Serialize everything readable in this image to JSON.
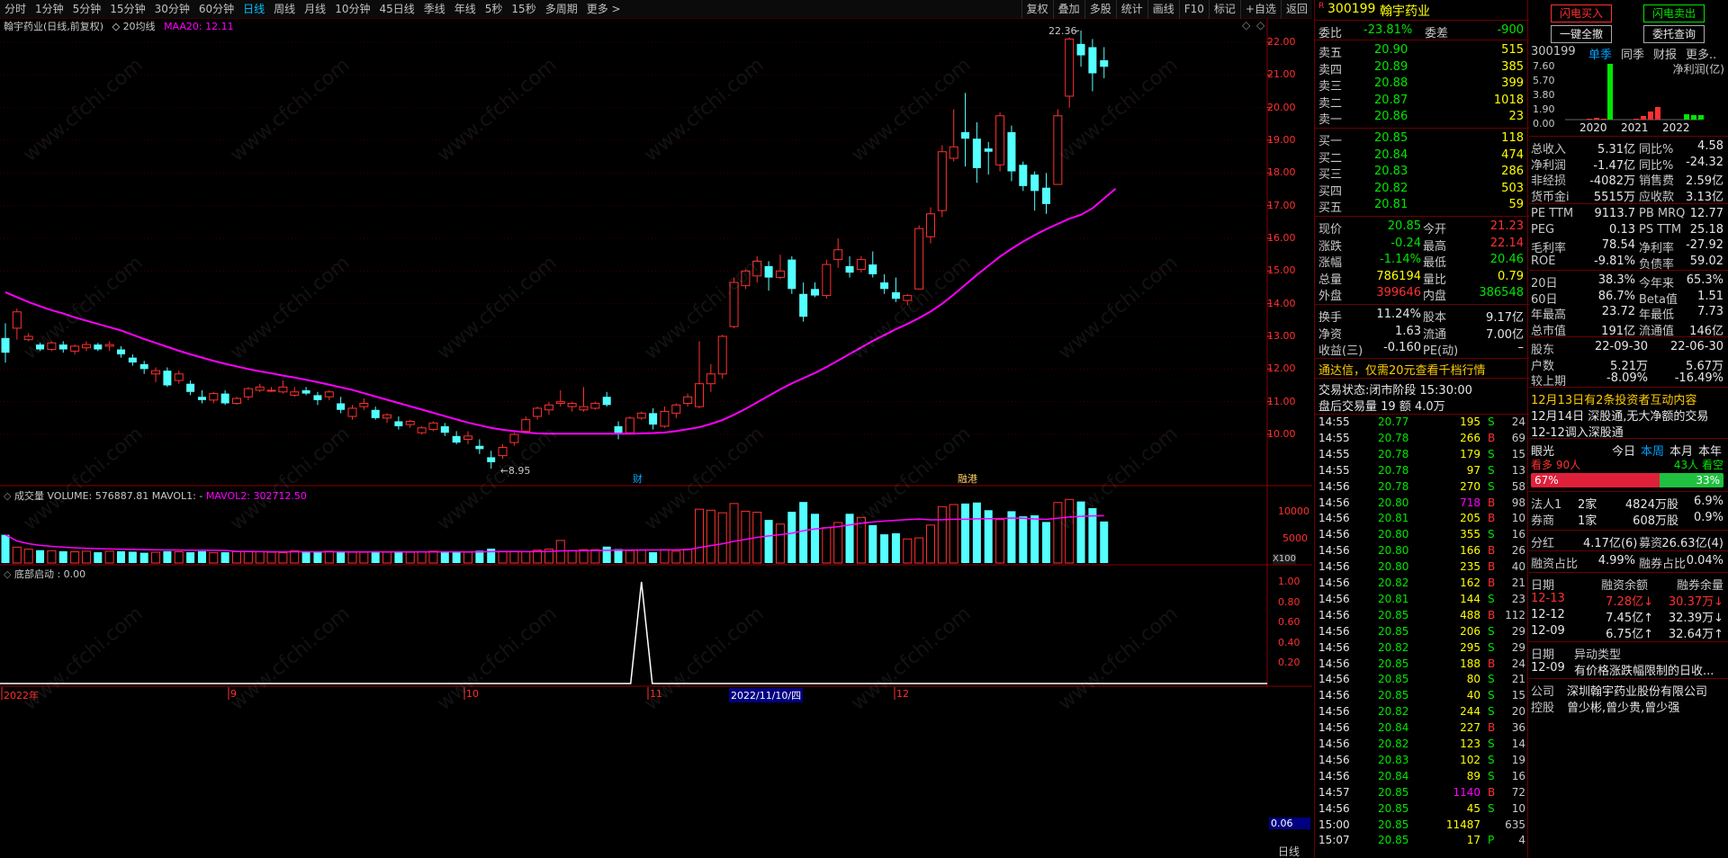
{
  "toolbar": {
    "periods": [
      "分时",
      "1分钟",
      "5分钟",
      "15分钟",
      "30分钟",
      "60分钟",
      "日线",
      "周线",
      "月线",
      "10分钟",
      "45日线",
      "季线",
      "年线",
      "5秒",
      "15秒",
      "多周期",
      "更多 >"
    ],
    "active_period": "日线",
    "right_buttons": [
      "复权",
      "叠加",
      "多股",
      "统计",
      "画线",
      "F10",
      "标记",
      "+自选",
      "返回"
    ]
  },
  "chart": {
    "title": "翰宇药业(日线,前复权)",
    "ma_label": "20均线",
    "ma_value": "MAA20: 12.11",
    "high_label": "22.36",
    "low_label": "8.95",
    "price_axis": [
      "22.00",
      "21.00",
      "20.00",
      "19.00",
      "18.00",
      "17.00",
      "16.00",
      "15.00",
      "14.00",
      "13.00",
      "12.00",
      "11.00",
      "10.00"
    ],
    "marker_cai": "财",
    "marker_tags": "融港",
    "volume_title": "成交量 VOLUME: 576887.81 MAVOL1: -",
    "volume_mavol2": "MAVOL2: 302712.50",
    "volume_axis": [
      "10000",
      "5000"
    ],
    "volume_unit": "X100",
    "bottom_title": "底部启动 : 0.00",
    "bottom_axis": [
      "1.00",
      "0.80",
      "0.60",
      "0.40",
      "0.20"
    ],
    "bottom_value": "0.06",
    "date_axis": [
      "2022年",
      "9",
      "10",
      "11",
      "2022/11/10/四",
      "12"
    ],
    "period_tab": "日线"
  },
  "chart_data": {
    "type": "candlestick",
    "title": "翰宇药业(日线,前复权)",
    "ylim": [
      8.5,
      22.6
    ],
    "candles": [
      [
        12.95,
        13.4,
        12.2,
        12.5
      ],
      [
        13.25,
        13.85,
        12.9,
        13.75
      ],
      [
        12.9,
        13.1,
        12.85,
        13.0
      ],
      [
        12.75,
        12.8,
        12.55,
        12.6
      ],
      [
        12.6,
        12.85,
        12.55,
        12.8
      ],
      [
        12.75,
        12.85,
        12.5,
        12.6
      ],
      [
        12.55,
        12.75,
        12.45,
        12.7
      ],
      [
        12.65,
        12.85,
        12.55,
        12.75
      ],
      [
        12.75,
        12.8,
        12.55,
        12.6
      ],
      [
        12.7,
        12.85,
        12.55,
        12.75
      ],
      [
        12.6,
        12.7,
        12.35,
        12.45
      ],
      [
        12.35,
        12.45,
        12.1,
        12.2
      ],
      [
        12.15,
        12.25,
        11.85,
        12.0
      ],
      [
        11.85,
        12.05,
        11.6,
        11.95
      ],
      [
        11.95,
        12.05,
        11.45,
        11.5
      ],
      [
        11.65,
        11.95,
        11.55,
        11.85
      ],
      [
        11.55,
        11.65,
        11.2,
        11.3
      ],
      [
        11.15,
        11.35,
        10.95,
        11.05
      ],
      [
        11.05,
        11.3,
        10.95,
        11.25
      ],
      [
        11.25,
        11.35,
        10.9,
        10.95
      ],
      [
        10.95,
        11.15,
        10.9,
        11.1
      ],
      [
        11.15,
        11.45,
        11.05,
        11.4
      ],
      [
        11.35,
        11.55,
        11.3,
        11.45
      ],
      [
        11.35,
        11.45,
        11.3,
        11.35
      ],
      [
        11.3,
        11.65,
        11.25,
        11.45
      ],
      [
        11.2,
        11.45,
        11.15,
        11.3
      ],
      [
        11.35,
        11.45,
        11.2,
        11.25
      ],
      [
        11.2,
        11.3,
        10.9,
        11.05
      ],
      [
        11.15,
        11.35,
        11.05,
        11.3
      ],
      [
        10.95,
        11.15,
        10.65,
        10.75
      ],
      [
        10.55,
        10.9,
        10.45,
        10.8
      ],
      [
        10.85,
        11.1,
        10.75,
        10.95
      ],
      [
        10.75,
        10.85,
        10.45,
        10.5
      ],
      [
        10.5,
        10.65,
        10.35,
        10.6
      ],
      [
        10.4,
        10.55,
        10.15,
        10.25
      ],
      [
        10.3,
        10.45,
        10.2,
        10.4
      ],
      [
        10.05,
        10.25,
        10.0,
        10.2
      ],
      [
        10.15,
        10.4,
        10.1,
        10.35
      ],
      [
        10.25,
        10.35,
        9.95,
        10.05
      ],
      [
        9.95,
        10.1,
        9.7,
        9.75
      ],
      [
        9.85,
        10.1,
        9.7,
        9.95
      ],
      [
        9.65,
        9.85,
        9.4,
        9.55
      ],
      [
        9.3,
        9.5,
        8.95,
        9.15
      ],
      [
        9.35,
        9.7,
        9.25,
        9.6
      ],
      [
        9.75,
        10.05,
        9.65,
        10.0
      ],
      [
        10.1,
        10.55,
        10.05,
        10.45
      ],
      [
        10.55,
        10.85,
        10.45,
        10.8
      ],
      [
        10.75,
        11.0,
        10.6,
        10.9
      ],
      [
        10.95,
        11.35,
        10.85,
        11.0
      ],
      [
        10.85,
        11.0,
        10.7,
        10.95
      ],
      [
        10.75,
        11.45,
        10.7,
        10.85
      ],
      [
        10.8,
        11.0,
        10.75,
        10.95
      ],
      [
        11.15,
        11.3,
        10.85,
        10.9
      ],
      [
        10.25,
        10.4,
        9.85,
        10.05
      ],
      [
        10.05,
        10.55,
        10.0,
        10.5
      ],
      [
        10.5,
        10.7,
        10.45,
        10.65
      ],
      [
        10.65,
        10.8,
        10.15,
        10.3
      ],
      [
        10.25,
        10.85,
        10.2,
        10.7
      ],
      [
        10.65,
        10.95,
        10.5,
        10.9
      ],
      [
        10.95,
        11.25,
        10.85,
        11.15
      ],
      [
        10.85,
        12.85,
        10.8,
        11.55
      ],
      [
        11.55,
        12.15,
        11.3,
        11.85
      ],
      [
        11.85,
        13.05,
        11.7,
        13.0
      ],
      [
        13.3,
        14.8,
        13.25,
        14.65
      ],
      [
        14.55,
        15.05,
        14.45,
        15.0
      ],
      [
        14.85,
        15.45,
        14.65,
        15.3
      ],
      [
        15.15,
        15.3,
        14.4,
        14.8
      ],
      [
        14.8,
        15.5,
        14.75,
        15.0
      ],
      [
        15.35,
        15.45,
        14.3,
        14.45
      ],
      [
        14.3,
        14.65,
        13.45,
        13.6
      ],
      [
        14.45,
        14.65,
        14.2,
        14.25
      ],
      [
        14.25,
        15.35,
        14.15,
        15.2
      ],
      [
        15.35,
        16.0,
        15.1,
        15.65
      ],
      [
        15.15,
        15.45,
        14.8,
        14.95
      ],
      [
        15.05,
        15.45,
        14.95,
        15.35
      ],
      [
        15.2,
        15.6,
        14.8,
        14.9
      ],
      [
        14.65,
        14.9,
        14.3,
        14.45
      ],
      [
        14.35,
        14.8,
        14.05,
        14.15
      ],
      [
        14.1,
        14.3,
        13.95,
        14.25
      ],
      [
        14.45,
        16.4,
        14.45,
        16.3
      ],
      [
        16.05,
        16.95,
        15.85,
        16.75
      ],
      [
        16.85,
        18.85,
        16.65,
        18.65
      ],
      [
        18.45,
        19.95,
        18.35,
        18.8
      ],
      [
        19.25,
        20.45,
        18.2,
        19.05
      ],
      [
        19.05,
        19.55,
        17.7,
        18.15
      ],
      [
        18.75,
        18.95,
        17.95,
        18.65
      ],
      [
        18.25,
        19.85,
        18.05,
        19.75
      ],
      [
        19.25,
        19.45,
        17.75,
        18.05
      ],
      [
        18.25,
        18.35,
        17.45,
        17.6
      ],
      [
        17.95,
        18.05,
        16.85,
        17.45
      ],
      [
        17.55,
        18.0,
        16.75,
        17.05
      ],
      [
        17.65,
        19.95,
        17.65,
        19.75
      ],
      [
        20.35,
        22.15,
        20.0,
        22.1
      ],
      [
        21.95,
        22.36,
        21.25,
        21.6
      ],
      [
        21.85,
        22.1,
        20.5,
        21.05
      ],
      [
        21.45,
        21.85,
        20.9,
        21.25
      ]
    ],
    "ma20": [
      14.35,
      14.2,
      14.05,
      13.92,
      13.8,
      13.7,
      13.58,
      13.48,
      13.38,
      13.28,
      13.18,
      13.05,
      12.92,
      12.8,
      12.68,
      12.56,
      12.45,
      12.35,
      12.25,
      12.16,
      12.08,
      12.0,
      11.93,
      11.87,
      11.8,
      11.74,
      11.67,
      11.6,
      11.52,
      11.44,
      11.36,
      11.26,
      11.16,
      11.06,
      10.96,
      10.86,
      10.76,
      10.66,
      10.56,
      10.46,
      10.36,
      10.28,
      10.2,
      10.14,
      10.1,
      10.06,
      10.03,
      10.02,
      10.02,
      10.02,
      10.02,
      10.02,
      10.02,
      10.02,
      10.02,
      10.03,
      10.04,
      10.06,
      10.1,
      10.16,
      10.22,
      10.32,
      10.44,
      10.6,
      10.78,
      10.98,
      11.18,
      11.38,
      11.56,
      11.72,
      11.88,
      12.06,
      12.26,
      12.46,
      12.66,
      12.86,
      13.04,
      13.22,
      13.38,
      13.56,
      13.76,
      14.0,
      14.28,
      14.58,
      14.88,
      15.16,
      15.44,
      15.68,
      15.9,
      16.1,
      16.28,
      16.44,
      16.6,
      16.72,
      16.92,
      17.22,
      17.52
    ]
  },
  "book": {
    "code": "300199",
    "name": "翰宇药业",
    "weibi_label": "委比",
    "weibi": "-23.81%",
    "weicha_label": "委差",
    "weicha": "-900",
    "sells": [
      {
        "label": "卖五",
        "price": "20.90",
        "vol": "515"
      },
      {
        "label": "卖四",
        "price": "20.89",
        "vol": "385"
      },
      {
        "label": "卖三",
        "price": "20.88",
        "vol": "399"
      },
      {
        "label": "卖二",
        "price": "20.87",
        "vol": "1018"
      },
      {
        "label": "卖一",
        "price": "20.86",
        "vol": "23"
      }
    ],
    "buys": [
      {
        "label": "买一",
        "price": "20.85",
        "vol": "118"
      },
      {
        "label": "买二",
        "price": "20.84",
        "vol": "474"
      },
      {
        "label": "买三",
        "price": "20.83",
        "vol": "286"
      },
      {
        "label": "买四",
        "price": "20.82",
        "vol": "503"
      },
      {
        "label": "买五",
        "price": "20.81",
        "vol": "59"
      }
    ],
    "quotes": [
      {
        "l1": "现价",
        "v1": "20.85",
        "l2": "今开",
        "v2": "21.23"
      },
      {
        "l1": "涨跌",
        "v1": "-0.24",
        "l2": "最高",
        "v2": "22.14"
      },
      {
        "l1": "涨幅",
        "v1": "-1.14%",
        "l2": "最低",
        "v2": "20.46"
      },
      {
        "l1": "总量",
        "v1": "786194",
        "l2": "量比",
        "v2": "0.79"
      },
      {
        "l1": "外盘",
        "v1": "399646",
        "l2": "内盘",
        "v2": "386548"
      }
    ],
    "stats": [
      {
        "l1": "换手",
        "v1": "11.24%",
        "l2": "股本",
        "v2": "9.17亿"
      },
      {
        "l1": "净资",
        "v1": "1.63",
        "l2": "流通",
        "v2": "7.00亿"
      },
      {
        "l1": "收益(三)",
        "v1": "-0.160",
        "l2": "PE(动)",
        "v2": "–"
      }
    ],
    "promo": "通达信，仅需20元查看千档行情",
    "status": "交易状态:闭市阶段 15:30:00",
    "after": "盘后交易量 19 额 4.0万",
    "ticks": [
      [
        "14:55",
        "20.77",
        "195",
        "S",
        "24"
      ],
      [
        "14:55",
        "20.78",
        "266",
        "B",
        "69"
      ],
      [
        "14:55",
        "20.78",
        "179",
        "S",
        "15"
      ],
      [
        "14:55",
        "20.78",
        "97",
        "S",
        "13"
      ],
      [
        "14:56",
        "20.78",
        "270",
        "S",
        "58"
      ],
      [
        "14:56",
        "20.80",
        "718",
        "B",
        "98"
      ],
      [
        "14:56",
        "20.81",
        "205",
        "B",
        "10"
      ],
      [
        "14:56",
        "20.80",
        "355",
        "S",
        "16"
      ],
      [
        "14:56",
        "20.80",
        "166",
        "B",
        "26"
      ],
      [
        "14:56",
        "20.80",
        "235",
        "B",
        "40"
      ],
      [
        "14:56",
        "20.82",
        "162",
        "B",
        "21"
      ],
      [
        "14:56",
        "20.81",
        "144",
        "S",
        "23"
      ],
      [
        "14:56",
        "20.85",
        "488",
        "B",
        "112"
      ],
      [
        "14:56",
        "20.85",
        "206",
        "S",
        "29"
      ],
      [
        "14:56",
        "20.82",
        "295",
        "S",
        "29"
      ],
      [
        "14:56",
        "20.85",
        "188",
        "B",
        "24"
      ],
      [
        "14:56",
        "20.85",
        "80",
        "S",
        "21"
      ],
      [
        "14:56",
        "20.85",
        "40",
        "S",
        "15"
      ],
      [
        "14:56",
        "20.82",
        "244",
        "S",
        "20"
      ],
      [
        "14:56",
        "20.84",
        "227",
        "B",
        "36"
      ],
      [
        "14:56",
        "20.82",
        "123",
        "S",
        "14"
      ],
      [
        "14:56",
        "20.83",
        "102",
        "S",
        "19"
      ],
      [
        "14:56",
        "20.84",
        "89",
        "S",
        "16"
      ],
      [
        "14:57",
        "20.85",
        "1140",
        "B",
        "72"
      ],
      [
        "14:56",
        "20.85",
        "45",
        "S",
        "10"
      ],
      [
        "15:00",
        "20.85",
        "11487",
        "",
        "635"
      ],
      [
        "15:07",
        "20.85",
        "17",
        "P",
        "4"
      ]
    ]
  },
  "info": {
    "flash_buy": "闪电买入",
    "flash_sell": "闪电卖出",
    "one_key": "一键全撤",
    "order_query": "委托查询",
    "code": "300199",
    "tabs": [
      "单季",
      "同季",
      "财报",
      "更多.."
    ],
    "metric": "净利润(亿)",
    "bar_axis": [
      "7.60",
      "5.70",
      "3.80",
      "1.90",
      "0.00"
    ],
    "bar_years": [
      "2020",
      "2021",
      "2022"
    ],
    "fin": [
      {
        "l1": "总收入",
        "v1": "5.31亿",
        "l2": "同比%",
        "v2": "4.58"
      },
      {
        "l1": "净利润",
        "v1": "-1.47亿",
        "l2": "同比%",
        "v2": "-24.32"
      },
      {
        "l1": "非经损",
        "v1": "-4082万",
        "l2": "销售费",
        "v2": "2.59亿"
      },
      {
        "l1": "货币金i",
        "v1": "5515万",
        "l2": "应收款",
        "v2": "3.13亿"
      }
    ],
    "val": [
      {
        "l1": "PE TTM",
        "v1": "9113.7",
        "l2": "PB MRQ",
        "v2": "12.77"
      },
      {
        "l1": "PEG",
        "v1": "0.13",
        "l2": "PS TTM",
        "v2": "25.18"
      },
      {
        "l1": "毛利率",
        "v1": "78.54",
        "l2": "净利率",
        "v2": "-27.92"
      },
      {
        "l1": "ROE",
        "v1": "-9.81%",
        "l2": "负债率",
        "v2": "59.02"
      }
    ],
    "perf": [
      {
        "l1": "20日",
        "v1": "38.3%",
        "l2": "今年来",
        "v2": "65.3%"
      },
      {
        "l1": "60日",
        "v1": "86.7%",
        "l2": "Beta值",
        "v2": "1.51"
      },
      {
        "l1": "年最高",
        "v1": "23.72",
        "l2": "年最低",
        "v2": "7.73"
      },
      {
        "l1": "总市值",
        "v1": "191亿",
        "l2": "流通值",
        "v2": "146亿"
      }
    ],
    "holders": [
      {
        "l1": "股东",
        "v1": "22-09-30",
        "v2": "22-06-30"
      },
      {
        "l1": "户数",
        "v1": "5.21万",
        "v2": "5.67万"
      },
      {
        "l1": "较上期",
        "v1": "-8.09%",
        "v2": "-16.49%"
      }
    ],
    "news": [
      "12月13日有2条投资者互动内容",
      "12月14日 深股通,无大净额的交易",
      "12-12调入深股通"
    ],
    "vision": {
      "label": "眼光",
      "tabs": [
        "今日",
        "本周",
        "本月",
        "本年"
      ],
      "bull": "看多 90人",
      "bear": "43人 看空",
      "bull_pct": "67%",
      "bear_pct": "33%"
    },
    "inst": [
      {
        "l1": "法人1",
        "v1": "2家",
        "v2": "4824万股",
        "v3": "6.9%"
      },
      {
        "l1": "券商",
        "v1": "1家",
        "v2": "608万股",
        "v3": "0.9%"
      }
    ],
    "dividend": {
      "l1": "分红",
      "v1": "4.17亿(6)",
      "l2": "募资",
      "v2": "26.63亿(4)"
    },
    "margin_ratio": {
      "l1": "融资占比",
      "v1": "4.99%",
      "l2": "融券占比",
      "v2": "0.04%"
    },
    "margin_head": [
      "日期",
      "融资余额",
      "融券余量"
    ],
    "margin": [
      [
        "12-13",
        "7.28亿↓",
        "30.37万↓"
      ],
      [
        "12-12",
        "7.45亿↑",
        "32.39万↓"
      ],
      [
        "12-09",
        "6.75亿↑",
        "32.64万↑"
      ]
    ],
    "abn_head": [
      "日期",
      "异动类型"
    ],
    "abn": [
      "12-09",
      "有价格涨跌幅限制的日收..."
    ],
    "company": {
      "l1": "公司",
      "v1": "深圳翰宇药业股份有限公司"
    },
    "control": {
      "l1": "控股",
      "v1": "曾少彬,曾少贵,曾少强"
    }
  },
  "colors": {
    "up": "#ff3030",
    "down": "#54ffff",
    "ma": "#ff00ff",
    "grid": "#6b0000",
    "accent": "#00c0ff"
  }
}
